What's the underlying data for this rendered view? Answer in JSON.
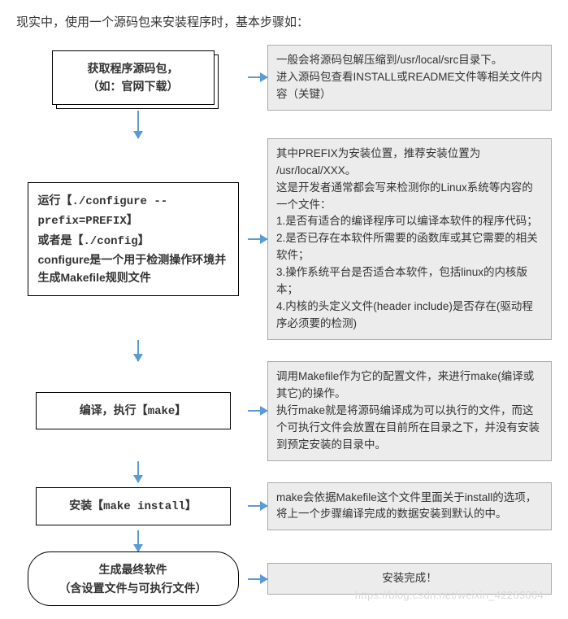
{
  "intro": "现实中，使用一个源码包来安装程序时，基本步骤如：",
  "steps": {
    "s1": {
      "title_line1": "获取程序源码包，",
      "title_line2": "（如：官网下载）",
      "desc_l1": "一般会将源码包解压缩到/usr/local/src目录下。",
      "desc_l2": "进入源码包查看INSTALL或README文件等相关文件内容（关键）"
    },
    "s2": {
      "t1a": "运行【",
      "t1b": "./configure --prefix=PREFIX",
      "t1c": "】",
      "t2a": "或者是【",
      "t2b": "./config",
      "t2c": "】",
      "t3a": "configure是一个用于检测操作环境并生成Makefile规则文件",
      "d1": "其中PREFIX为安装位置，推荐安装位置为",
      "d2": "/usr/local/XXX。",
      "d3": "这是开发者通常都会写来检测你的Linux系统等内容的一个文件：",
      "d4": "1.是否有适合的编译程序可以编译本软件的程序代码；",
      "d5": "2.是否已存在本软件所需要的函数库或其它需要的相关软件；",
      "d6": "3.操作系统平台是否适合本软件，包括linux的内核版本；",
      "d7": "4.内核的头定义文件(header include)是否存在(驱动程序必须要的检测)"
    },
    "s3": {
      "t_a": "编译，执行【",
      "t_b": "make",
      "t_c": "】",
      "d1": "调用Makefile作为它的配置文件，来进行make(编译或其它)的操作。",
      "d2": "执行make就是将源码编译成为可以执行的文件，而这个可执行文件会放置在目前所在目录之下，并没有安装到预定安装的目录中。"
    },
    "s4": {
      "t_a": "安装【",
      "t_b": "make install",
      "t_c": "】",
      "d1": "make会依据Makefile这个文件里面关于install的选项，将上一个步骤编译完成的数据安装到默认的中。"
    },
    "s5": {
      "t1": "生成最终软件",
      "t2": "（含设置文件与可执行文件）",
      "d1": "安装完成！"
    }
  },
  "watermark": "https://blog.csdn.net/weixin_42263604"
}
